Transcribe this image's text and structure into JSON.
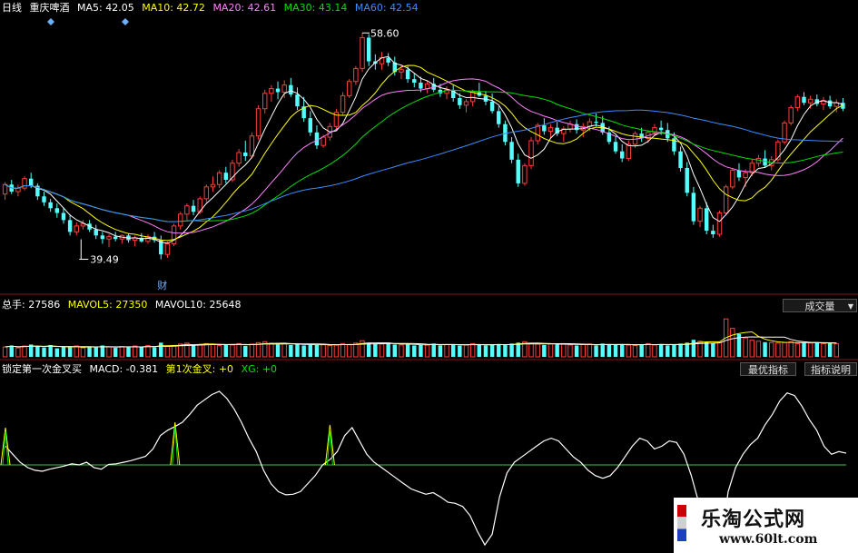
{
  "top_legend": {
    "period": "日线",
    "stock": "重庆啤酒",
    "ma5": "MA5: 42.05",
    "ma10": "MA10: 42.72",
    "ma20": "MA20: 42.61",
    "ma30": "MA30: 43.14",
    "ma60": "MA60: 42.54"
  },
  "volume_legend": {
    "total": "总手: 27586",
    "mavol5": "MAVOL5: 27350",
    "mavol10": "MAVOL10: 25648",
    "dropdown": "成交量"
  },
  "indicator_legend": {
    "name": "锁定第一次金叉买",
    "macd": "MACD: -0.381",
    "first": "第1次金叉: +0",
    "xg": "XG: +0",
    "best_button": "最优指标",
    "help_button": "指标说明"
  },
  "watermark": {
    "title": "乐淘公式网",
    "url": "www.60lt.com"
  },
  "colors": {
    "up": "#ff3c3c",
    "down": "#54ffff",
    "ma5": "#ffffff",
    "ma10": "#ffff00",
    "ma20": "#ff80ff",
    "ma30": "#00e000",
    "ma60": "#3c8cff",
    "macd": "#ffffff",
    "signal": "#ffff00",
    "zero": "#40c040",
    "frame": "#801818"
  },
  "chart_data": [
    {
      "type": "candlestick",
      "title": "重庆啤酒",
      "annotations": [
        {
          "label": "58.60",
          "value": 58.6
        },
        {
          "label": "39.49",
          "value": 39.49
        },
        {
          "label": "财"
        }
      ],
      "ylim": [
        37,
        60
      ],
      "candles": [
        [
          45,
          46,
          44.5,
          45.8
        ],
        [
          45.8,
          46.2,
          45,
          45.2
        ],
        [
          45.2,
          45.8,
          44.8,
          45.5
        ],
        [
          45.5,
          46.5,
          45.3,
          46.3
        ],
        [
          46.3,
          46.8,
          45.5,
          45.7
        ],
        [
          45.7,
          45.9,
          44.5,
          44.8
        ],
        [
          44.8,
          45.2,
          44,
          44.3
        ],
        [
          44.3,
          44.6,
          43.5,
          43.8
        ],
        [
          43.8,
          44.2,
          43,
          43.4
        ],
        [
          43.4,
          43.8,
          42.5,
          42.8
        ],
        [
          42.8,
          43.3,
          41.5,
          41.8
        ],
        [
          41.8,
          42.6,
          41.5,
          42.3
        ],
        [
          42.3,
          42.8,
          42,
          42.5
        ],
        [
          42.5,
          42.8,
          41.8,
          42
        ],
        [
          42,
          42.4,
          41.2,
          41.5
        ],
        [
          41.5,
          41.8,
          40.8,
          41.2
        ],
        [
          41.2,
          41.6,
          40.5,
          41.4
        ],
        [
          41.4,
          41.8,
          41,
          41.2
        ],
        [
          41.2,
          41.6,
          40.8,
          41.5
        ],
        [
          41.5,
          41.7,
          40.9,
          41.1
        ],
        [
          41.1,
          41.5,
          40.6,
          41.3
        ],
        [
          41.3,
          41.7,
          40.9,
          41.0
        ],
        [
          41.0,
          41.6,
          40.8,
          41.4
        ],
        [
          41.4,
          41.8,
          40.9,
          41.1
        ],
        [
          41.1,
          41.5,
          39.49,
          39.9
        ],
        [
          39.9,
          41.0,
          39.6,
          40.8
        ],
        [
          40.8,
          42.5,
          40.6,
          42.3
        ],
        [
          42.3,
          43.5,
          42.0,
          43.3
        ],
        [
          43.3,
          44.2,
          42.8,
          44.0
        ],
        [
          44.0,
          44.5,
          43.2,
          43.5
        ],
        [
          43.5,
          44.8,
          43.3,
          44.6
        ],
        [
          44.6,
          45.8,
          44.3,
          45.6
        ],
        [
          45.6,
          46.5,
          45.2,
          45.8
        ],
        [
          45.8,
          47.0,
          45.5,
          46.8
        ],
        [
          46.8,
          47.3,
          45.9,
          46.2
        ],
        [
          46.2,
          47.9,
          46.0,
          47.6
        ],
        [
          47.6,
          48.8,
          47.3,
          48.5
        ],
        [
          48.5,
          49.5,
          47.8,
          48.2
        ],
        [
          48.2,
          50.2,
          48.0,
          49.9
        ],
        [
          49.9,
          52.5,
          49.6,
          52.2
        ],
        [
          52.2,
          53.8,
          51.8,
          53.5
        ],
        [
          53.5,
          54.2,
          52.8,
          53.9
        ],
        [
          53.9,
          54.5,
          53.0,
          53.6
        ],
        [
          53.6,
          54.6,
          53.1,
          54.2
        ],
        [
          54.2,
          54.8,
          53.2,
          53.4
        ],
        [
          53.4,
          54.0,
          52.1,
          52.4
        ],
        [
          52.4,
          53.2,
          51.1,
          51.4
        ],
        [
          51.4,
          52.0,
          49.9,
          50.2
        ],
        [
          50.2,
          50.8,
          48.8,
          49.1
        ],
        [
          49.1,
          50.0,
          48.9,
          49.8
        ],
        [
          49.8,
          51.0,
          49.5,
          50.7
        ],
        [
          50.7,
          52.2,
          50.4,
          51.9
        ],
        [
          51.9,
          53.6,
          51.6,
          53.3
        ],
        [
          53.3,
          54.7,
          53.1,
          54.5
        ],
        [
          54.5,
          55.8,
          54.2,
          55.6
        ],
        [
          55.6,
          58.6,
          55.3,
          58.2
        ],
        [
          58.2,
          58.5,
          55.8,
          56.2
        ],
        [
          56.2,
          56.8,
          55.5,
          56.0
        ],
        [
          56.0,
          57.0,
          55.5,
          56.5
        ],
        [
          56.5,
          56.9,
          55.8,
          56.1
        ],
        [
          56.1,
          56.6,
          55.0,
          55.3
        ],
        [
          55.3,
          55.9,
          54.7,
          55.5
        ],
        [
          55.5,
          55.8,
          54.4,
          54.7
        ],
        [
          54.7,
          55.2,
          54.0,
          54.4
        ],
        [
          54.4,
          54.9,
          53.6,
          53.9
        ],
        [
          53.9,
          54.6,
          53.5,
          54.3
        ],
        [
          54.3,
          54.8,
          53.6,
          53.8
        ],
        [
          53.8,
          54.3,
          53.2,
          53.5
        ],
        [
          53.5,
          54.1,
          53.0,
          53.8
        ],
        [
          53.8,
          54.2,
          52.8,
          53.1
        ],
        [
          53.1,
          53.5,
          52.2,
          52.5
        ],
        [
          52.5,
          53.0,
          51.9,
          52.8
        ],
        [
          52.8,
          53.8,
          52.4,
          53.6
        ],
        [
          53.6,
          54.4,
          53.2,
          53.3
        ],
        [
          53.3,
          53.7,
          52.5,
          52.8
        ],
        [
          52.8,
          53.5,
          51.8,
          52.0
        ],
        [
          52.0,
          52.4,
          50.6,
          50.9
        ],
        [
          50.9,
          51.2,
          49.1,
          49.4
        ],
        [
          49.4,
          49.8,
          47.6,
          47.9
        ],
        [
          47.9,
          48.4,
          45.6,
          45.9
        ],
        [
          45.9,
          47.6,
          45.7,
          47.4
        ],
        [
          47.4,
          49.8,
          47.1,
          49.5
        ],
        [
          49.5,
          51.0,
          49.2,
          50.8
        ],
        [
          50.8,
          51.4,
          50.0,
          50.3
        ],
        [
          50.3,
          50.9,
          49.7,
          50.6
        ],
        [
          50.6,
          51.1,
          49.9,
          50.1
        ],
        [
          50.1,
          50.7,
          49.4,
          50.5
        ],
        [
          50.5,
          51.2,
          50.2,
          50.9
        ],
        [
          50.9,
          51.3,
          50.1,
          50.4
        ],
        [
          50.4,
          51.0,
          49.8,
          50.7
        ],
        [
          50.7,
          51.4,
          50.3,
          51.1
        ],
        [
          51.1,
          51.8,
          50.7,
          51.0
        ],
        [
          51.0,
          51.6,
          50.0,
          50.2
        ],
        [
          50.2,
          50.7,
          49.2,
          49.4
        ],
        [
          49.4,
          49.9,
          48.4,
          48.6
        ],
        [
          48.6,
          49.2,
          47.7,
          48.0
        ],
        [
          48.0,
          49.5,
          47.8,
          49.2
        ],
        [
          49.2,
          50.3,
          48.9,
          50.1
        ],
        [
          50.1,
          50.6,
          49.4,
          49.7
        ],
        [
          49.7,
          50.4,
          49.3,
          50.2
        ],
        [
          50.2,
          50.9,
          49.9,
          50.6
        ],
        [
          50.6,
          51.2,
          50.0,
          50.4
        ],
        [
          50.4,
          51.0,
          49.4,
          49.7
        ],
        [
          49.7,
          50.2,
          48.3,
          48.6
        ],
        [
          48.6,
          49.0,
          46.9,
          47.2
        ],
        [
          47.2,
          47.7,
          44.8,
          45.1
        ],
        [
          45.1,
          45.6,
          42.4,
          42.7
        ],
        [
          42.7,
          44.0,
          42.2,
          43.8
        ],
        [
          43.8,
          44.3,
          41.6,
          41.9
        ],
        [
          41.9,
          42.4,
          41.3,
          41.6
        ],
        [
          41.6,
          43.6,
          41.4,
          43.4
        ],
        [
          43.4,
          45.8,
          43.2,
          45.6
        ],
        [
          45.6,
          47.2,
          45.4,
          47.0
        ],
        [
          47.0,
          47.6,
          46.1,
          46.4
        ],
        [
          46.4,
          47.1,
          45.6,
          46.8
        ],
        [
          46.8,
          47.9,
          46.5,
          47.6
        ],
        [
          47.6,
          48.3,
          47.3,
          48.0
        ],
        [
          48.0,
          48.7,
          47.2,
          47.4
        ],
        [
          47.4,
          48.2,
          47.0,
          47.9
        ],
        [
          47.9,
          49.6,
          47.7,
          49.4
        ],
        [
          49.4,
          51.2,
          49.2,
          51.0
        ],
        [
          51.0,
          52.5,
          50.8,
          52.3
        ],
        [
          52.3,
          53.4,
          52.0,
          53.2
        ],
        [
          53.2,
          53.6,
          52.5,
          52.7
        ],
        [
          52.7,
          53.3,
          52.2,
          53.0
        ],
        [
          53.0,
          53.4,
          52.4,
          52.6
        ],
        [
          52.6,
          53.2,
          52.1,
          52.9
        ],
        [
          52.9,
          53.3,
          52.2,
          52.4
        ],
        [
          52.4,
          53.0,
          51.9,
          52.7
        ],
        [
          52.7,
          53.1,
          52.0,
          52.2
        ]
      ]
    },
    {
      "type": "bar",
      "title": "成交量",
      "series_names": [
        "总手",
        "MAVOL5",
        "MAVOL10"
      ],
      "ylim": [
        0,
        90000
      ],
      "values": [
        21000,
        24000,
        19000,
        23000,
        26000,
        22000,
        20000,
        25000,
        18000,
        21000,
        20000,
        23000,
        19000,
        22000,
        20000,
        24000,
        21000,
        19000,
        22000,
        20000,
        23000,
        21000,
        24000,
        20000,
        30000,
        22000,
        24000,
        27000,
        29000,
        26000,
        25000,
        28000,
        27000,
        24000,
        26000,
        25000,
        28000,
        23000,
        27000,
        30000,
        32000,
        29000,
        26000,
        28000,
        25000,
        27000,
        24000,
        26000,
        25000,
        27000,
        24000,
        25000,
        28000,
        26000,
        29000,
        34000,
        30000,
        28000,
        27000,
        29000,
        26000,
        25000,
        27000,
        24000,
        26000,
        25000,
        28000,
        24000,
        26000,
        27000,
        24000,
        25000,
        28000,
        26000,
        24000,
        25000,
        27000,
        26000,
        28000,
        30000,
        32000,
        29000,
        27000,
        25000,
        27000,
        26000,
        28000,
        25000,
        24000,
        26000,
        27000,
        24000,
        28000,
        25000,
        26000,
        27000,
        25000,
        24000,
        26000,
        28000,
        25000,
        27000,
        24000,
        26000,
        28000,
        30000,
        36000,
        33000,
        31000,
        29000,
        30000,
        80000,
        60000,
        48000,
        40000,
        35000,
        33000,
        31000,
        30000,
        29000,
        30000,
        32000,
        28000,
        30000,
        29000,
        31000,
        28000,
        29000,
        27586
      ]
    },
    {
      "type": "line",
      "title": "锁定第一次金叉买",
      "series_names": [
        "MACD",
        "第1次金叉"
      ],
      "ylim": [
        -1.6,
        1.6
      ],
      "macd": [
        0.35,
        0.2,
        0.05,
        -0.05,
        -0.1,
        -0.12,
        -0.08,
        -0.05,
        -0.02,
        0.02,
        0.0,
        0.05,
        -0.05,
        -0.08,
        0.01,
        0.02,
        0.05,
        0.08,
        0.12,
        0.16,
        0.3,
        0.55,
        0.65,
        0.72,
        0.8,
        0.95,
        1.12,
        1.22,
        1.32,
        1.38,
        1.25,
        1.05,
        0.8,
        0.5,
        0.25,
        -0.1,
        -0.35,
        -0.5,
        -0.56,
        -0.55,
        -0.5,
        -0.35,
        -0.2,
        0.0,
        0.1,
        0.25,
        0.55,
        0.7,
        0.45,
        0.2,
        0.05,
        -0.05,
        -0.15,
        -0.25,
        -0.35,
        -0.45,
        -0.5,
        -0.55,
        -0.52,
        -0.6,
        -0.7,
        -0.72,
        -0.78,
        -0.95,
        -1.25,
        -1.5,
        -1.3,
        -0.6,
        -0.15,
        0.05,
        0.15,
        0.25,
        0.35,
        0.45,
        0.5,
        0.45,
        0.3,
        0.15,
        0.05,
        -0.1,
        -0.2,
        -0.25,
        -0.2,
        -0.05,
        0.15,
        0.35,
        0.5,
        0.45,
        0.3,
        0.35,
        0.45,
        0.42,
        0.2,
        -0.2,
        -0.7,
        -1.3,
        -1.8,
        -1.5,
        -0.5,
        -0.05,
        0.2,
        0.38,
        0.5,
        0.75,
        0.95,
        1.2,
        1.35,
        1.3,
        1.1,
        0.85,
        0.65,
        0.35,
        0.2,
        0.25,
        0.22
      ],
      "signal_spikes": [
        {
          "at": 0,
          "value": 0.7
        },
        {
          "at": 23,
          "value": 0.8
        },
        {
          "at": 44,
          "value": 0.75
        }
      ]
    }
  ]
}
